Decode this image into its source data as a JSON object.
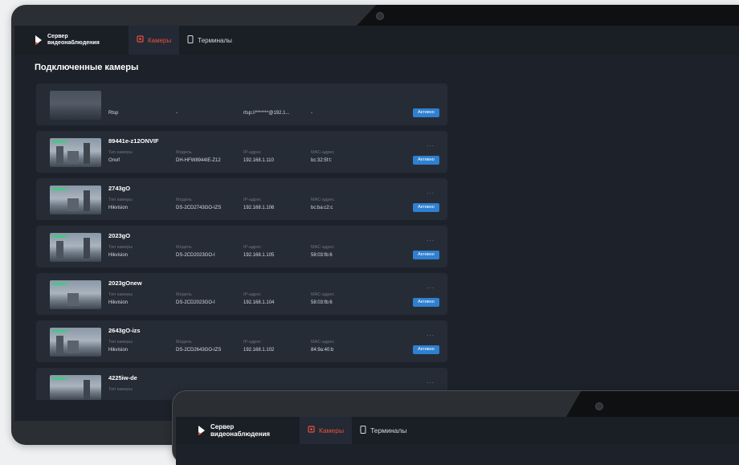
{
  "app": {
    "logo_line1": "Сервер",
    "logo_line2": "видеонаблюдения"
  },
  "nav": {
    "tabs": [
      {
        "label": "Камеры",
        "active": true
      },
      {
        "label": "Терминалы",
        "active": false
      }
    ]
  },
  "page": {
    "title": "Подключенные камеры"
  },
  "labels": {
    "type": "Тип камеры",
    "model": "Модель",
    "ip": "IP-адрес",
    "mac": "MAC-адрес",
    "status": "Активно",
    "more": "..."
  },
  "cameras": [
    {
      "name": "",
      "type": "Rtsp",
      "model": "-",
      "ip": "rtsp://*******@192.1...",
      "mac": "-"
    },
    {
      "name": "89441e-z12ONVIF",
      "type": "Onvif",
      "model": "DH-HFW8944IE-Z12",
      "ip": "192.168.1.110",
      "mac": "bc:32:5f:t:"
    },
    {
      "name": "2743gO",
      "type": "Hikvision",
      "model": "DS-2CD2743GO-IZS",
      "ip": "192.168.1.106",
      "mac": "bc:ba:c2:c"
    },
    {
      "name": "2023gO",
      "type": "Hikvision",
      "model": "DS-2CD2023GO-I",
      "ip": "192.168.1.105",
      "mac": "58:03:fb:6"
    },
    {
      "name": "2023gOnew",
      "type": "Hikvision",
      "model": "DS-2CD2023GO-I",
      "ip": "192.168.1.104",
      "mac": "58:03:fb:6"
    },
    {
      "name": "2643gO-izs",
      "type": "Hikvision",
      "model": "DS-2CD2643GO-IZS",
      "ip": "192.168.1.102",
      "mac": "84:9a:40:b"
    },
    {
      "name": "4225iw-de",
      "type": "",
      "model": "",
      "ip": "",
      "mac": ""
    }
  ],
  "colors": {
    "accent": "#e8523a",
    "badge": "#2f80d0",
    "background": "#1d222a",
    "card": "#262c36"
  }
}
